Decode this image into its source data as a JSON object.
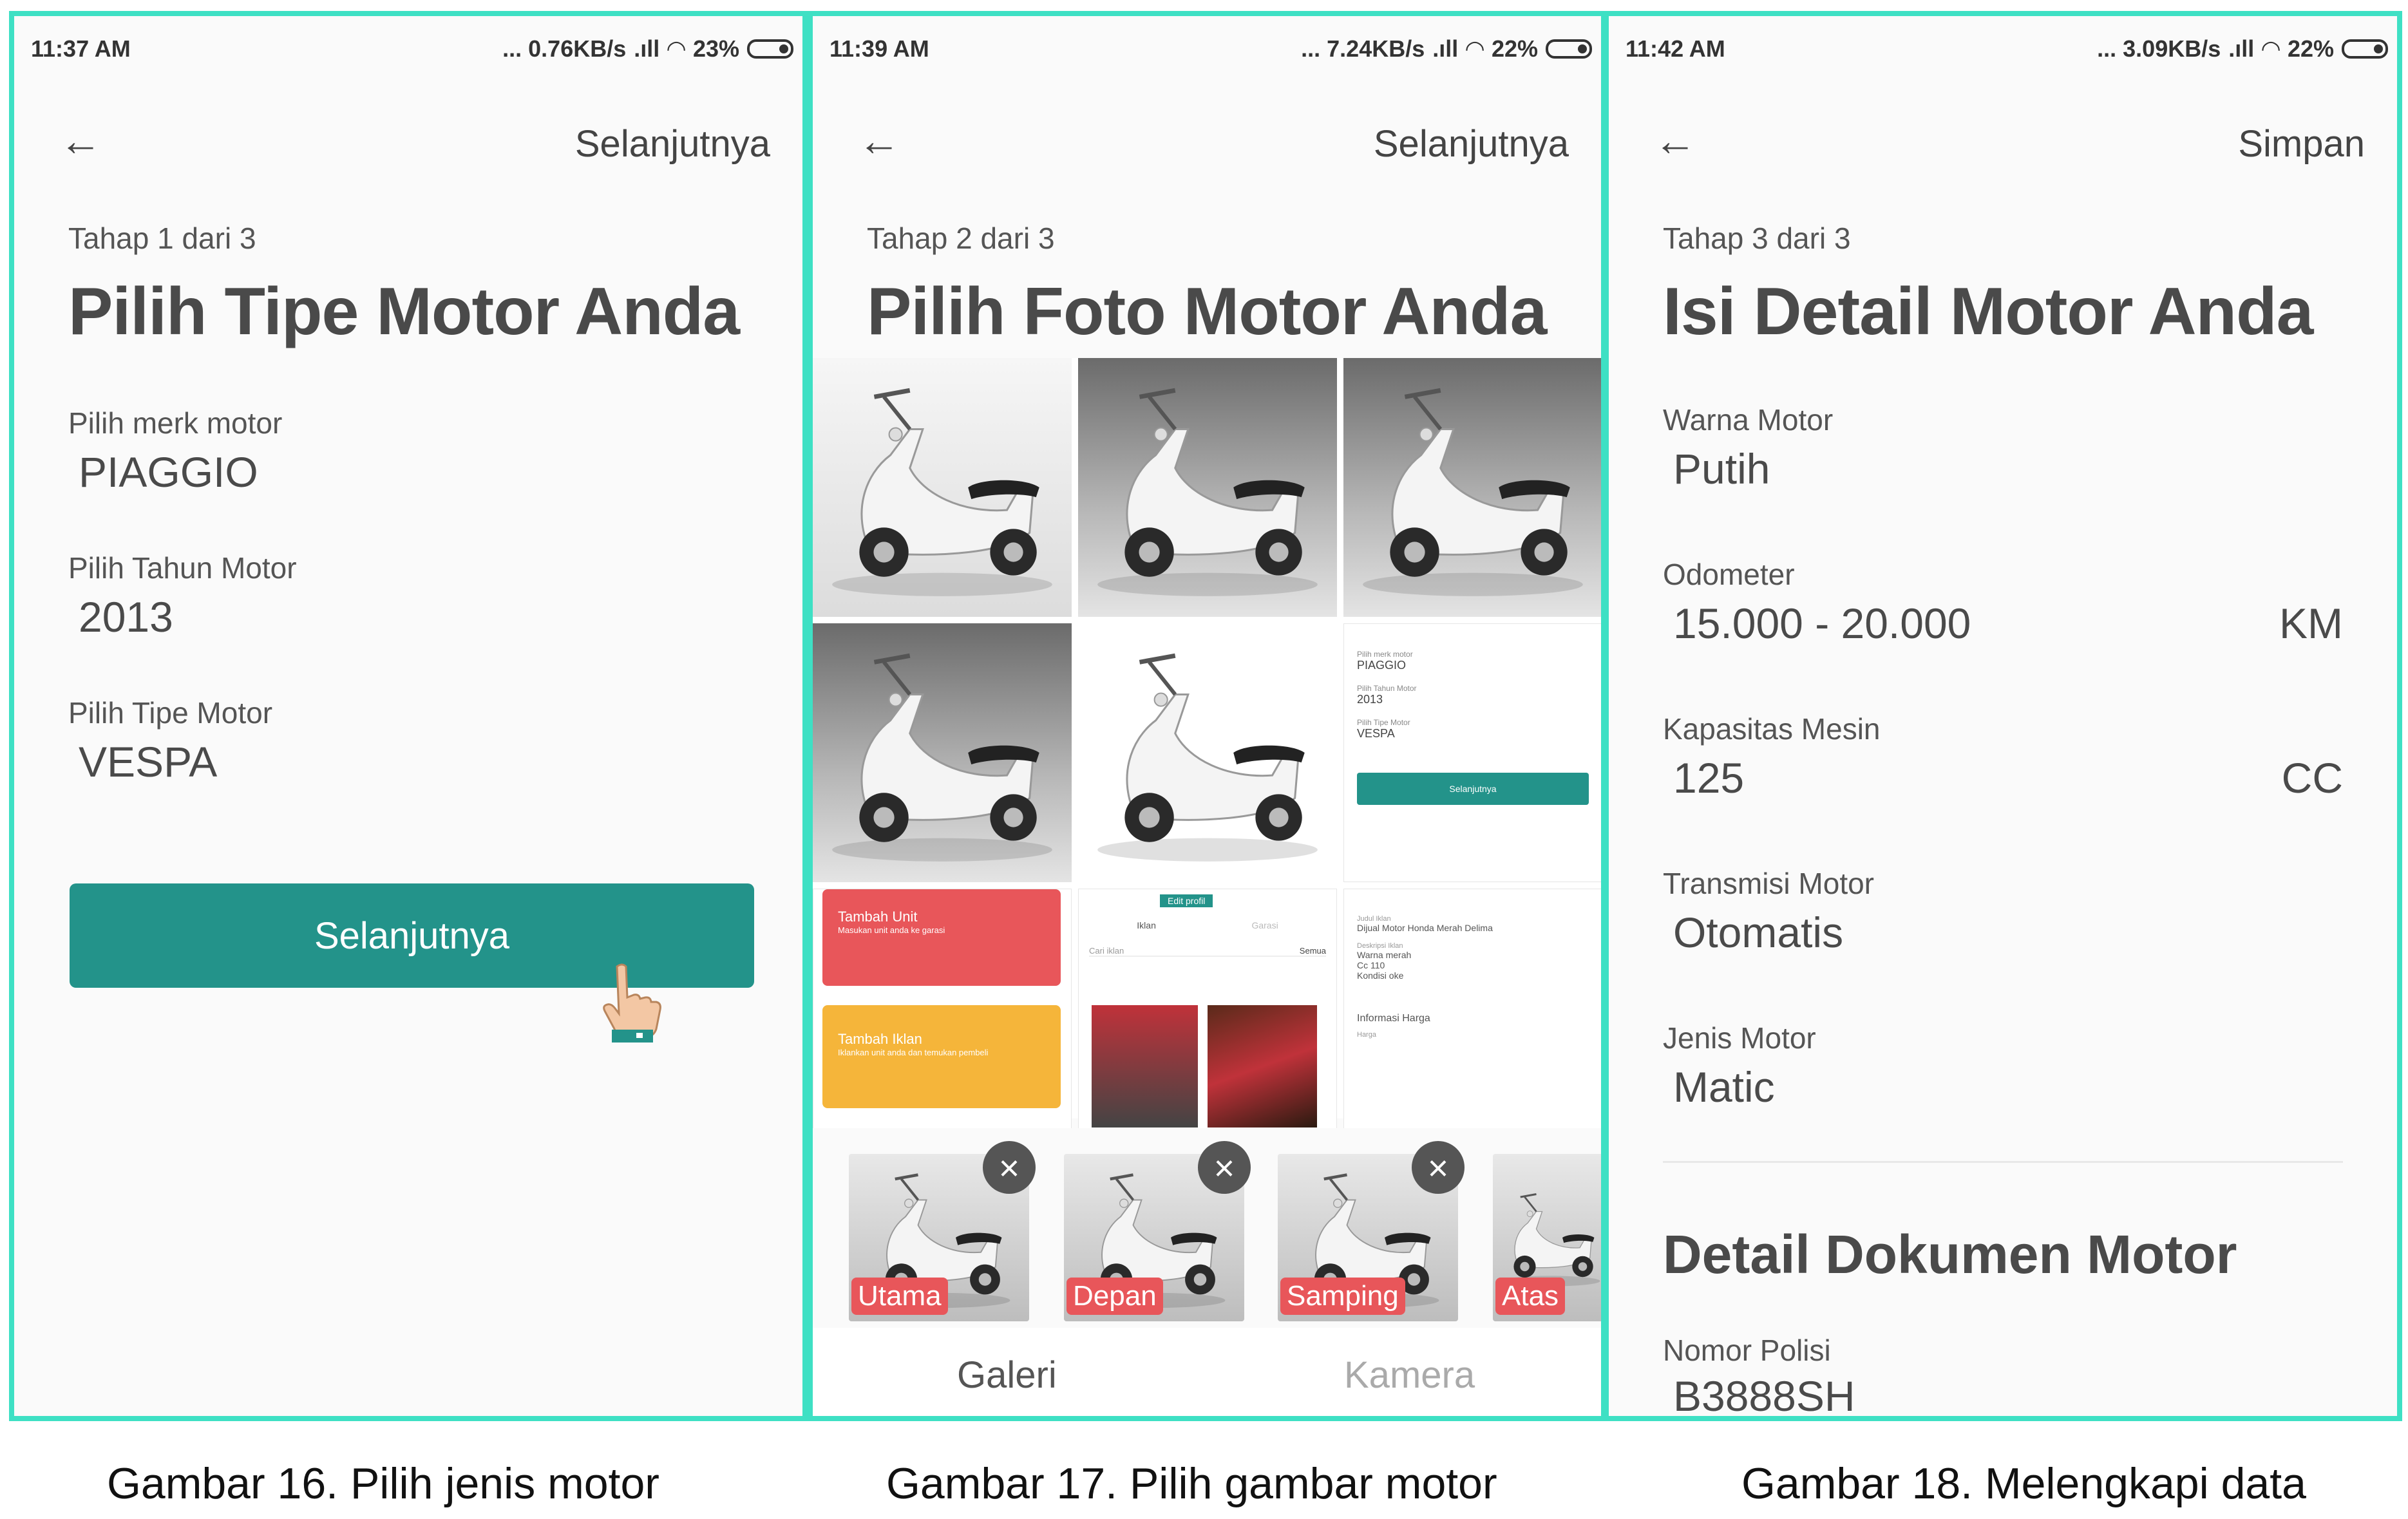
{
  "screens": [
    {
      "status": {
        "time": "11:37 AM",
        "speed": "... 0.76KB/s",
        "battery": "23%"
      },
      "header": {
        "back_icon": "arrow-left-icon",
        "action_label": "Selanjutnya"
      },
      "step": "Tahap 1 dari 3",
      "title": "Pilih Tipe Motor Anda",
      "fields": [
        {
          "label": "Pilih merk motor",
          "value": "PIAGGIO"
        },
        {
          "label": "Pilih Tahun Motor",
          "value": "2013"
        },
        {
          "label": "Pilih Tipe Motor",
          "value": "VESPA"
        }
      ],
      "primary_button": "Selanjutnya",
      "cursor_icon": "pointing-hand-icon"
    },
    {
      "status": {
        "time": "11:39 AM",
        "speed": "... 7.24KB/s",
        "battery": "22%"
      },
      "header": {
        "back_icon": "arrow-left-icon",
        "action_label": "Selanjutnya"
      },
      "step": "Tahap 2 dari 3",
      "title": "Pilih Foto Motor Anda",
      "gallery_shots": {
        "shot1": {
          "labels": [
            "Pilih merk motor",
            "PIAGGIO",
            "Pilih Tahun Motor",
            "2013",
            "Pilih Tipe Motor",
            "VESPA"
          ],
          "button": "Selanjutnya"
        },
        "shot2": {
          "tambah_unit": "Tambah Unit",
          "tambah_unit_sub": "Masukan unit anda ke garasi",
          "tambah_iklan": "Tambah Iklan",
          "tambah_iklan_sub": "Iklankan unit anda dan temukan pembeli"
        },
        "shot3": {
          "edit_profil": "Edit profil",
          "tab_iklan": "Iklan",
          "tab_garasi": "Garasi",
          "cari": "Cari iklan",
          "filter": "Semua"
        },
        "shot4": {
          "judul_label": "Judul Iklan",
          "judul": "Dijual Motor Honda Merah Delima",
          "desk_label": "Deskripsi Iklan",
          "desk": [
            "Warna merah",
            "Cc 110",
            "Kondisi oke"
          ],
          "info_harga": "Informasi Harga",
          "harga_label": "Harga"
        }
      },
      "selected": [
        {
          "label": "Utama"
        },
        {
          "label": "Depan"
        },
        {
          "label": "Samping"
        },
        {
          "label": "Atas"
        }
      ],
      "close_label": "×",
      "tabs": {
        "active": "Galeri",
        "inactive": "Kamera"
      }
    },
    {
      "status": {
        "time": "11:42 AM",
        "speed": "... 3.09KB/s",
        "battery": "22%"
      },
      "header": {
        "back_icon": "arrow-left-icon",
        "action_label": "Simpan"
      },
      "step": "Tahap 3 dari 3",
      "title": "Isi Detail Motor Anda",
      "fields": [
        {
          "label": "Warna Motor",
          "value": "Putih",
          "unit": ""
        },
        {
          "label": "Odometer",
          "value": "15.000 - 20.000",
          "unit": "KM"
        },
        {
          "label": "Kapasitas Mesin",
          "value": "125",
          "unit": "CC"
        },
        {
          "label": "Transmisi Motor",
          "value": "Otomatis",
          "unit": ""
        },
        {
          "label": "Jenis Motor",
          "value": "Matic",
          "unit": ""
        }
      ],
      "doc_section_title": "Detail Dokumen Motor",
      "doc_fields": [
        {
          "label": "Nomor Polisi",
          "value": "B3888SH"
        }
      ]
    }
  ],
  "captions": [
    "Gambar 16. Pilih jenis motor",
    "Gambar 17. Pilih gambar motor",
    "Gambar 18. Melengkapi data"
  ],
  "colors": {
    "frame": "#3ee0c4",
    "primary": "#23938a",
    "tag": "#e8565a"
  }
}
